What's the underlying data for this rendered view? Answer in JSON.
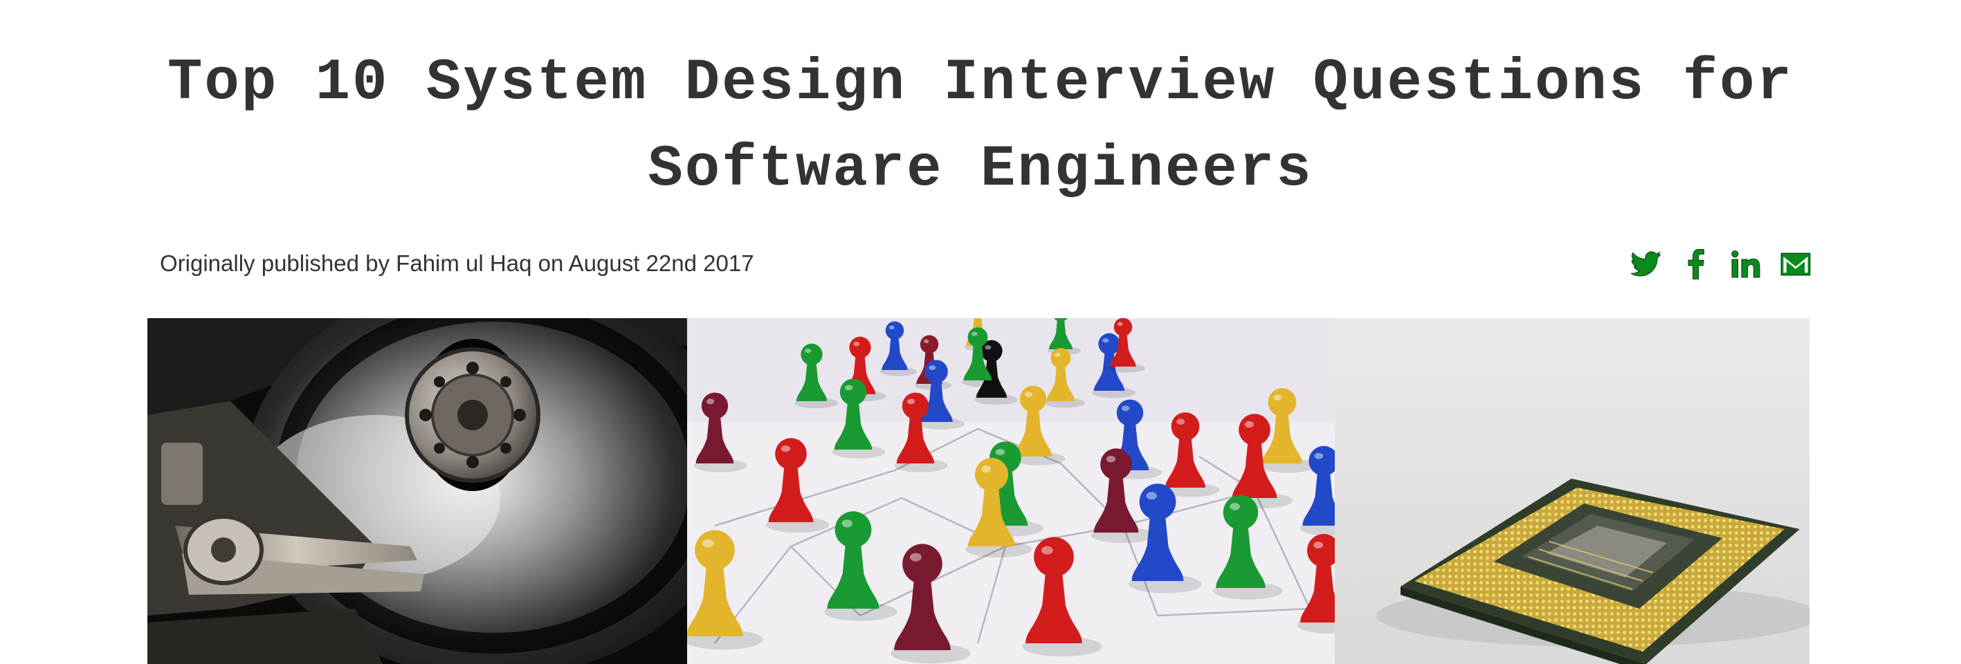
{
  "article": {
    "title": "Top 10 System Design Interview Questions for Software Engineers",
    "byline": "Originally published by Fahim ul Haq on August 22nd 2017"
  },
  "share": {
    "icons": [
      "twitter-icon",
      "facebook-icon",
      "linkedin-icon",
      "email-icon"
    ],
    "color": "#0b8a1c"
  },
  "hero": {
    "panels": [
      {
        "name": "hard-drive-image"
      },
      {
        "name": "pawn-network-image"
      },
      {
        "name": "cpu-chip-image"
      }
    ]
  },
  "colors": {
    "title": "#333333",
    "text": "#333333",
    "background": "#ffffff"
  }
}
